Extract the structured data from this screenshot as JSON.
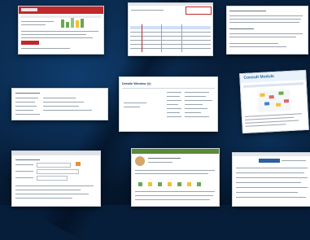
{
  "screen": {
    "background": "#071e3a",
    "accent": "#c0282c"
  },
  "thumbnails": [
    {
      "id": "t1",
      "title": "",
      "header_color": "#c0282c"
    },
    {
      "id": "t2",
      "title": "",
      "header_color": "#1f5fa8"
    },
    {
      "id": "t3",
      "title": "",
      "header_color": "#222222"
    },
    {
      "id": "t4",
      "title": "",
      "header_color": "#ffffff"
    },
    {
      "id": "t5",
      "title": "Details Window (#)",
      "header_color": "#1f5fa8"
    },
    {
      "id": "t6",
      "title": "Consult Module",
      "header_color": "#2a6aa3"
    },
    {
      "id": "t7",
      "title": "",
      "header_color": "#dfe3e8"
    },
    {
      "id": "t8",
      "title": "",
      "header_color": "#5a8a3a"
    },
    {
      "id": "t9",
      "title": "",
      "header_color": "#2e5f9e"
    }
  ]
}
